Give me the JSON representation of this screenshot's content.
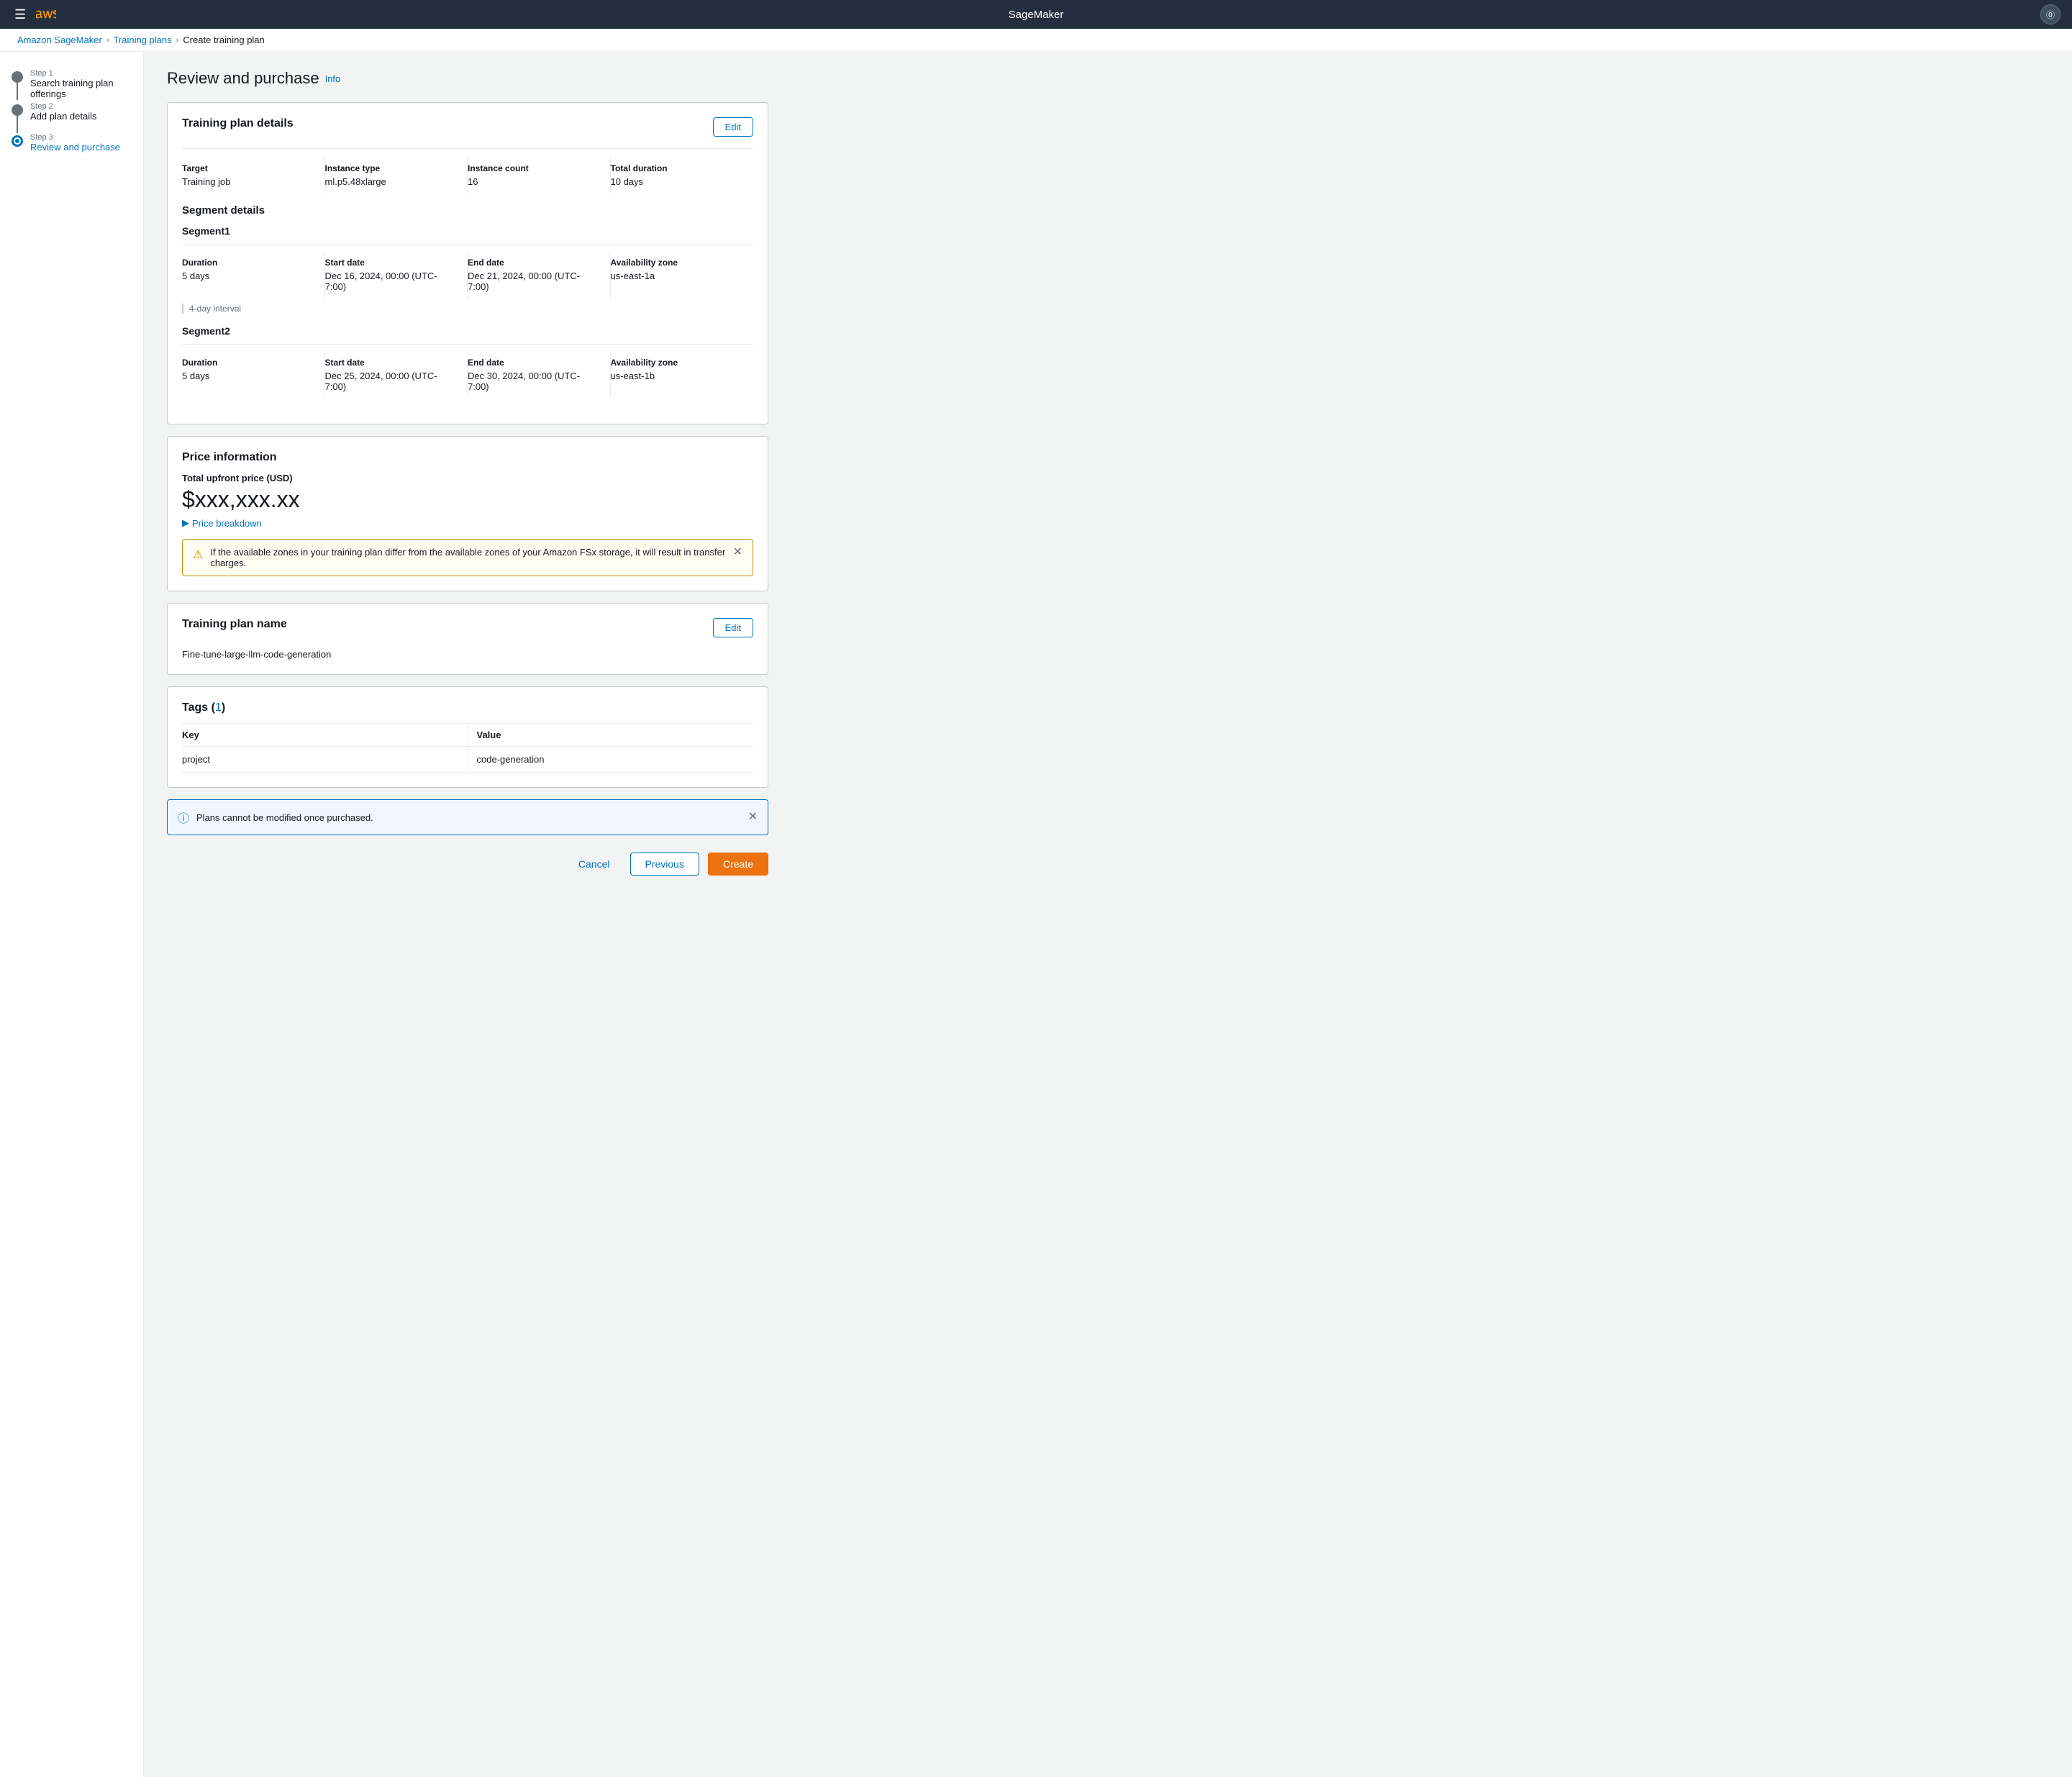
{
  "app": {
    "name": "SageMaker"
  },
  "breadcrumb": {
    "items": [
      {
        "label": "Amazon SageMaker",
        "href": "#"
      },
      {
        "label": "Training plans",
        "href": "#"
      },
      {
        "label": "Create training plan"
      }
    ]
  },
  "sidebar": {
    "steps": [
      {
        "id": "step1",
        "label": "Step 1",
        "title": "Search training plan offerings",
        "state": "done"
      },
      {
        "id": "step2",
        "label": "Step 2",
        "title": "Add plan details",
        "state": "done"
      },
      {
        "id": "step3",
        "label": "Step 3",
        "title": "Review and purchase",
        "state": "active"
      }
    ]
  },
  "page": {
    "title": "Review and purchase",
    "info_label": "Info"
  },
  "training_plan_details": {
    "card_title": "Training plan details",
    "edit_label": "Edit",
    "fields": {
      "target_label": "Target",
      "target_value": "Training job",
      "instance_type_label": "Instance type",
      "instance_type_value": "ml.p5.48xlarge",
      "instance_count_label": "Instance count",
      "instance_count_value": "16",
      "total_duration_label": "Total duration",
      "total_duration_value": "10 days"
    }
  },
  "segment_details": {
    "section_title": "Segment details",
    "segments": [
      {
        "title": "Segment1",
        "duration_label": "Duration",
        "duration_value": "5 days",
        "start_date_label": "Start date",
        "start_date_value": "Dec 16, 2024, 00:00 (UTC-7:00)",
        "end_date_label": "End date",
        "end_date_value": "Dec 21, 2024, 00:00 (UTC-7:00)",
        "availability_zone_label": "Availability zone",
        "availability_zone_value": "us-east-1a",
        "interval_label": "4-day interval"
      },
      {
        "title": "Segment2",
        "duration_label": "Duration",
        "duration_value": "5 days",
        "start_date_label": "Start date",
        "start_date_value": "Dec 25, 2024, 00:00 (UTC-7:00)",
        "end_date_label": "End date",
        "end_date_value": "Dec 30, 2024, 00:00 (UTC-7:00)",
        "availability_zone_label": "Availability zone",
        "availability_zone_value": "us-east-1b",
        "interval_label": null
      }
    ]
  },
  "price_information": {
    "card_title": "Price information",
    "total_label": "Total upfront price (USD)",
    "total_value": "$xxx,xxx.xx",
    "breakdown_label": "Price breakdown",
    "warning_text": "If the available zones in your training plan differ from the available zones of your Amazon FSx storage, it will result in transfer charges."
  },
  "training_plan_name": {
    "card_title": "Training plan name",
    "edit_label": "Edit",
    "name_value": "Fine-tune-large-llm-code-generation"
  },
  "tags": {
    "card_title": "Tags",
    "count": "1",
    "columns": {
      "key": "Key",
      "value": "Value"
    },
    "rows": [
      {
        "key": "project",
        "value": "code-generation"
      }
    ]
  },
  "notification": {
    "text": "Plans cannot be modified once purchased."
  },
  "actions": {
    "cancel_label": "Cancel",
    "previous_label": "Previous",
    "create_label": "Create"
  }
}
